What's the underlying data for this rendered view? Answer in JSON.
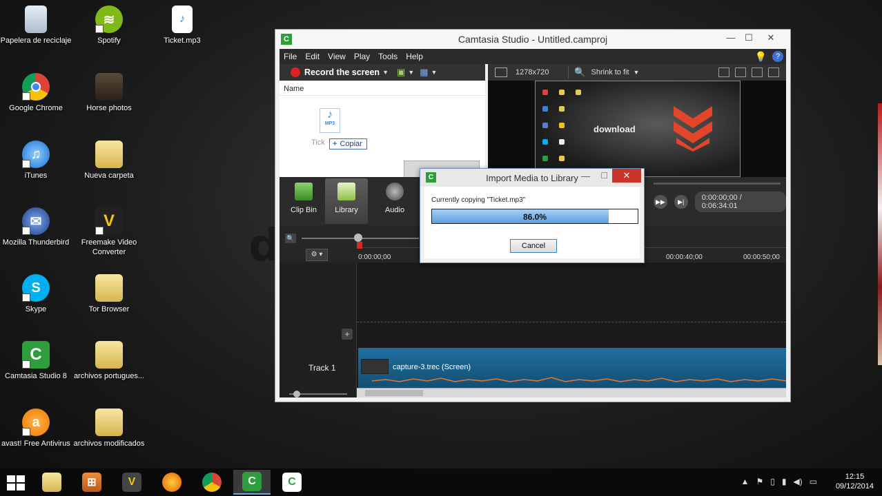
{
  "desktop": {
    "watermark": "d",
    "icons": [
      {
        "label": "Papelera de reciclaje",
        "icon": "recycle-bin-icon"
      },
      {
        "label": "Spotify",
        "icon": "spotify-icon"
      },
      {
        "label": "Ticket.mp3",
        "icon": "mp3-file-icon"
      },
      {
        "label": "Google Chrome",
        "icon": "chrome-icon"
      },
      {
        "label": "Horse photos",
        "icon": "folder-icon"
      },
      {
        "label": "iTunes",
        "icon": "itunes-icon"
      },
      {
        "label": "Nueva carpeta",
        "icon": "folder-icon"
      },
      {
        "label": "Mozilla Thunderbird",
        "icon": "thunderbird-icon"
      },
      {
        "label": "Freemake Video Converter",
        "icon": "freemake-icon"
      },
      {
        "label": "Skype",
        "icon": "skype-icon"
      },
      {
        "label": "Tor Browser",
        "icon": "folder-icon"
      },
      {
        "label": "Camtasia Studio 8",
        "icon": "camtasia-icon"
      },
      {
        "label": "archivos portugues...",
        "icon": "folder-icon"
      },
      {
        "label": "avast! Free Antivirus",
        "icon": "avast-icon"
      },
      {
        "label": "archivos modificados",
        "icon": "folder-icon"
      }
    ]
  },
  "window": {
    "title": "Camtasia Studio - Untitled.camproj",
    "app_icon_letter": "C",
    "minimize": "—",
    "maximize": "☐",
    "close": "✕",
    "menu": [
      "File",
      "Edit",
      "View",
      "Play",
      "Tools",
      "Help"
    ],
    "help_symbol": "?",
    "record_label": "Record the screen",
    "clipbin_header": "Name",
    "clip_name_partial": "Tick",
    "mp3_tag": "MP3",
    "copy_tooltip": "Copiar",
    "dimensions": "1278x720",
    "zoom_mode": "Shrink to fit",
    "preview_brand": "download",
    "tabs": [
      "Clip Bin",
      "Library",
      "Audio"
    ],
    "time_display": "0:00:00;00 / 0:06:34:01",
    "ruler_ticks": [
      "0:00:00;00",
      "00:00:40;00",
      "00:00:50;00"
    ],
    "track_label": "Track 1",
    "clip_label": "capture-3.trec (Screen)"
  },
  "dialog": {
    "title": "Import Media to Library",
    "message": "Currently copying \"Ticket.mp3\"",
    "progress": 0.86,
    "progress_text": "86.0%",
    "cancel_label": "Cancel"
  },
  "taskbar": {
    "apps": [
      "file-explorer-icon",
      "install-icon",
      "freemake-icon",
      "firefox-icon",
      "chrome-icon",
      "camtasia-icon",
      "camtasia-recorder-icon"
    ],
    "time": "12:15",
    "date": "09/12/2014"
  },
  "colors": {
    "accent": "#2e9e3c",
    "record": "#e02020",
    "progress_fill": "#5da0e0",
    "clip": "#1f6e9e",
    "close_red": "#c7352b"
  }
}
